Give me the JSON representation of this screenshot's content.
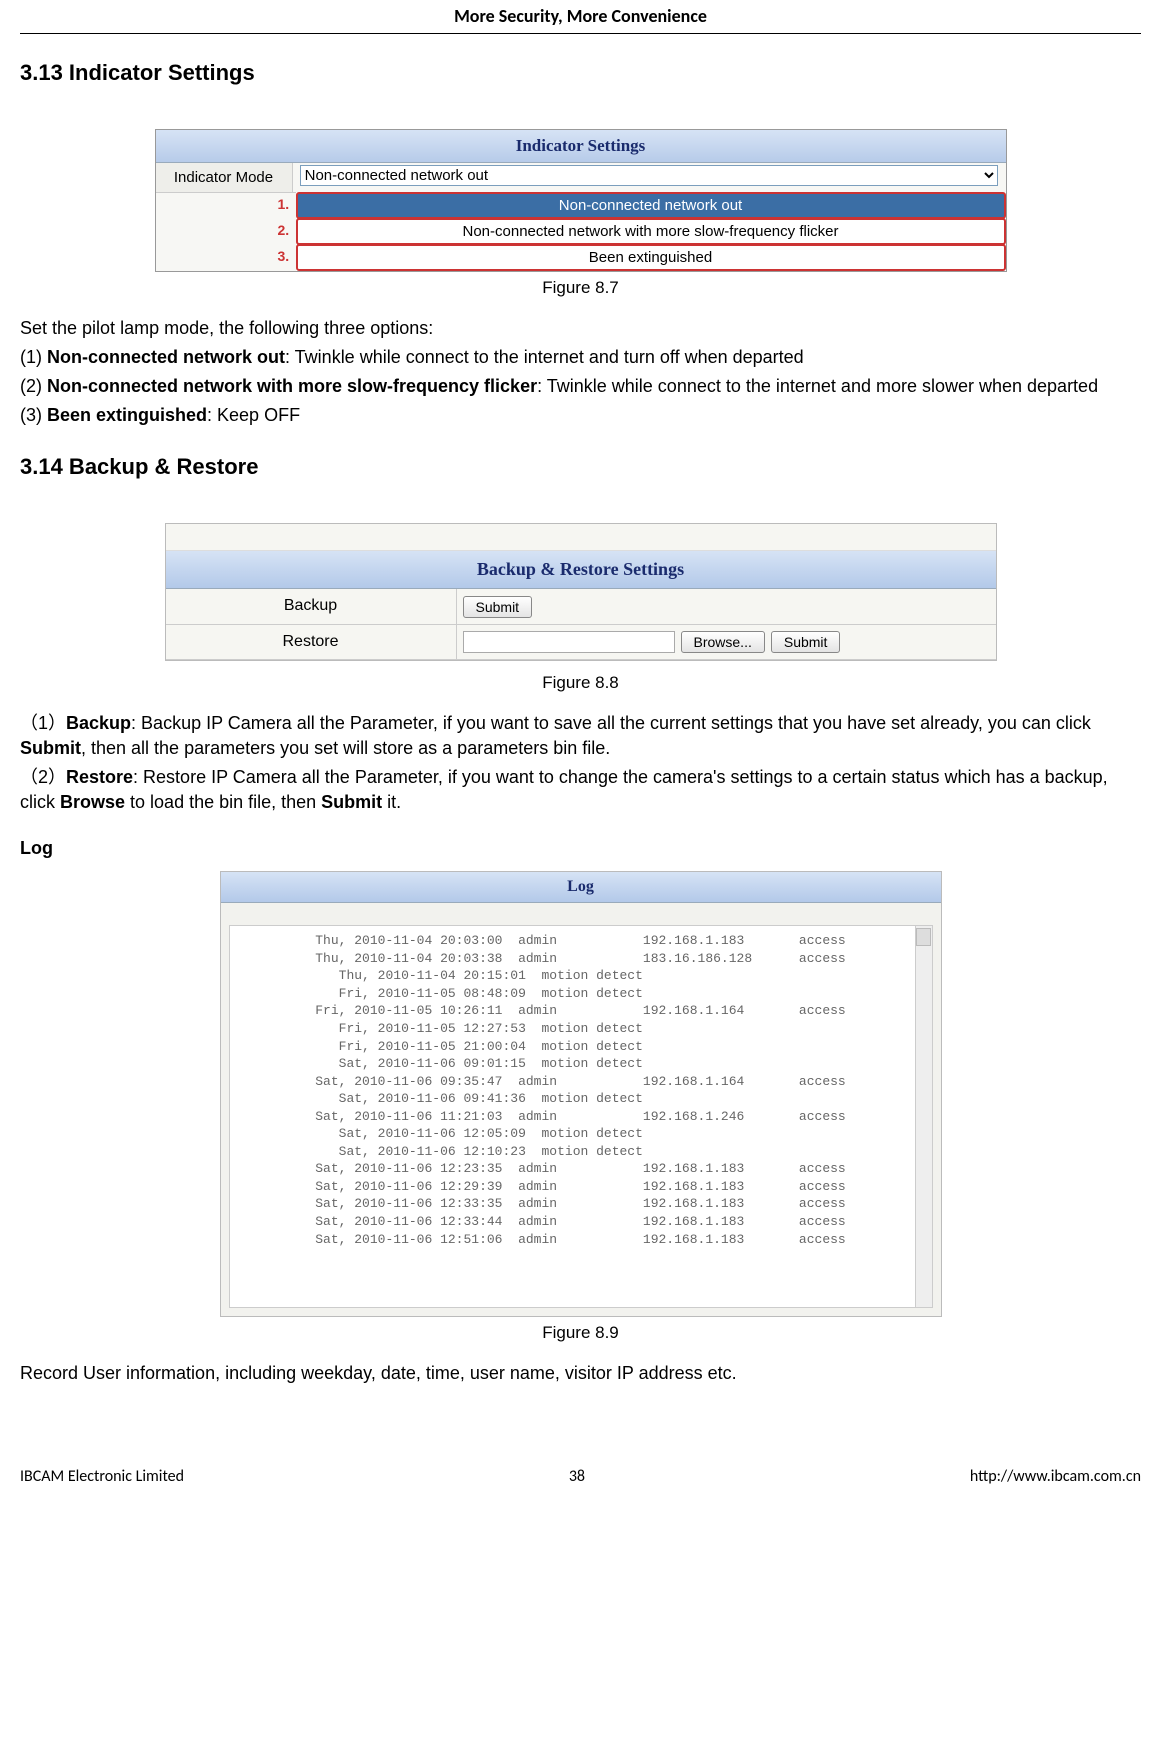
{
  "header": "More Security, More Convenience",
  "section_313": "3.13 Indicator Settings",
  "fig87_caption": "Figure 8.7",
  "fig87": {
    "title": "Indicator Settings",
    "label": "Indicator Mode",
    "selected": "Non-connected network out",
    "opt1_num": "1.",
    "opt1": "Non-connected network out",
    "opt2_num": "2.",
    "opt2": "Non-connected network with more slow-frequency flicker",
    "opt3_num": "3.",
    "opt3": "Been extinguished"
  },
  "p1_intro": "Set the pilot lamp mode, the following three options:",
  "p1_a": "(1) ",
  "p1_b": "Non-connected network out",
  "p1_c": ": Twinkle while connect to the internet and turn off when departed",
  "p2_a": "(2) ",
  "p2_b": "Non-connected network with more slow-frequency flicker",
  "p2_c": ": Twinkle while connect to the internet and more slower when departed",
  "p3_a": "(3) ",
  "p3_b": "Been extinguished",
  "p3_c": ": Keep OFF",
  "section_314": "3.14 Backup & Restore",
  "fig88": {
    "title": "Backup & Restore Settings",
    "backup_label": "Backup",
    "restore_label": "Restore",
    "submit": "Submit",
    "browse": "Browse..."
  },
  "fig88_caption": "Figure 8.8",
  "bk1_a": "（1）",
  "bk1_b": "Backup",
  "bk1_c": ": Backup IP Camera all the Parameter, if you want to save all the current settings that you have set already, you can click ",
  "bk1_d": "Submit",
  "bk1_e": ", then all the parameters you set will store as a parameters bin file.",
  "bk2_a": "（2）",
  "bk2_b": "Restore",
  "bk2_c": ": Restore IP Camera all the Parameter, if you want to change the camera's settings to a certain status which has a backup, click ",
  "bk2_d": "Browse",
  "bk2_e": " to load the bin file, then ",
  "bk2_f": "Submit",
  "bk2_g": " it.",
  "log_label": "Log",
  "fig89": {
    "title": "Log",
    "rows": [
      {
        "dt": "Thu, 2010-11-04 20:03:00",
        "u": "admin",
        "ip": "192.168.1.183",
        "a": "access"
      },
      {
        "dt": "Thu, 2010-11-04 20:03:38",
        "u": "admin",
        "ip": "183.16.186.128",
        "a": "access"
      },
      {
        "dt": "Thu, 2010-11-04 20:15:01",
        "u": "motion detect",
        "ip": "",
        "a": ""
      },
      {
        "dt": "Fri, 2010-11-05 08:48:09",
        "u": "motion detect",
        "ip": "",
        "a": ""
      },
      {
        "dt": "Fri, 2010-11-05 10:26:11",
        "u": "admin",
        "ip": "192.168.1.164",
        "a": "access"
      },
      {
        "dt": "Fri, 2010-11-05 12:27:53",
        "u": "motion detect",
        "ip": "",
        "a": ""
      },
      {
        "dt": "Fri, 2010-11-05 21:00:04",
        "u": "motion detect",
        "ip": "",
        "a": ""
      },
      {
        "dt": "Sat, 2010-11-06 09:01:15",
        "u": "motion detect",
        "ip": "",
        "a": ""
      },
      {
        "dt": "Sat, 2010-11-06 09:35:47",
        "u": "admin",
        "ip": "192.168.1.164",
        "a": "access"
      },
      {
        "dt": "Sat, 2010-11-06 09:41:36",
        "u": "motion detect",
        "ip": "",
        "a": ""
      },
      {
        "dt": "Sat, 2010-11-06 11:21:03",
        "u": "admin",
        "ip": "192.168.1.246",
        "a": "access"
      },
      {
        "dt": "Sat, 2010-11-06 12:05:09",
        "u": "motion detect",
        "ip": "",
        "a": ""
      },
      {
        "dt": "Sat, 2010-11-06 12:10:23",
        "u": "motion detect",
        "ip": "",
        "a": ""
      },
      {
        "dt": "Sat, 2010-11-06 12:23:35",
        "u": "admin",
        "ip": "192.168.1.183",
        "a": "access"
      },
      {
        "dt": "Sat, 2010-11-06 12:29:39",
        "u": "admin",
        "ip": "192.168.1.183",
        "a": "access"
      },
      {
        "dt": "Sat, 2010-11-06 12:33:35",
        "u": "admin",
        "ip": "192.168.1.183",
        "a": "access"
      },
      {
        "dt": "Sat, 2010-11-06 12:33:44",
        "u": "admin",
        "ip": "192.168.1.183",
        "a": "access"
      },
      {
        "dt": "Sat, 2010-11-06 12:51:06",
        "u": "admin",
        "ip": "192.168.1.183",
        "a": "access"
      }
    ]
  },
  "fig89_caption": "Figure 8.9",
  "log_desc": "Record User information, including weekday, date, time, user name, visitor IP address etc.",
  "footer": {
    "left": "IBCAM Electronic Limited",
    "center": "38",
    "right": "http://www.ibcam.com.cn"
  }
}
